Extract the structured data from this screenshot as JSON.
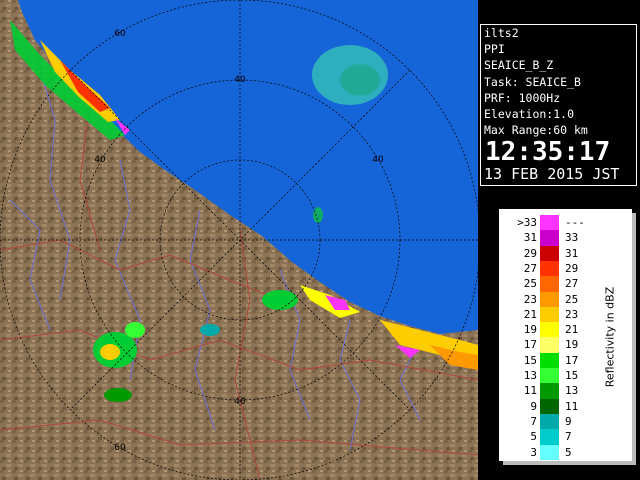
{
  "station": "ilts2",
  "product": "PPI",
  "field": "SEAICE_B_Z",
  "task": "Task: SEAICE_B",
  "prf": "PRF: 1000Hz",
  "elevation": "Elevation:1.0",
  "max_range": "Max Range:60 km",
  "time": "12:35:17",
  "date": "13 FEB 2015 JST",
  "range_ring_labels": [
    "60",
    "40",
    "40",
    "40",
    "40",
    "60"
  ],
  "legend": {
    "unit_label": "Reflectivity in dBZ",
    "rows": [
      {
        "lo": ">33",
        "hi": "---",
        "color": "#ff33ff"
      },
      {
        "lo": "31",
        "hi": "33",
        "color": "#cc00cc"
      },
      {
        "lo": "29",
        "hi": "31",
        "color": "#cc0000"
      },
      {
        "lo": "27",
        "hi": "29",
        "color": "#ff3300"
      },
      {
        "lo": "25",
        "hi": "27",
        "color": "#ff6600"
      },
      {
        "lo": "23",
        "hi": "25",
        "color": "#ff9900"
      },
      {
        "lo": "21",
        "hi": "23",
        "color": "#ffcc00"
      },
      {
        "lo": "19",
        "hi": "21",
        "color": "#ffff00"
      },
      {
        "lo": "17",
        "hi": "19",
        "color": "#ffff66"
      },
      {
        "lo": "15",
        "hi": "17",
        "color": "#00dd00"
      },
      {
        "lo": "13",
        "hi": "15",
        "color": "#33ff33"
      },
      {
        "lo": "11",
        "hi": "13",
        "color": "#009900"
      },
      {
        "lo": "9",
        "hi": "11",
        "color": "#006600"
      },
      {
        "lo": "7",
        "hi": "9",
        "color": "#00aaaa"
      },
      {
        "lo": "5",
        "hi": "7",
        "color": "#00cccc"
      },
      {
        "lo": "3",
        "hi": "5",
        "color": "#66ffff"
      }
    ]
  },
  "colors": {
    "sea": "#1565d8",
    "land": "#8c7355",
    "rivers": "#6f6fd6",
    "boundaries": "#b0473f",
    "rings": "#000000"
  }
}
